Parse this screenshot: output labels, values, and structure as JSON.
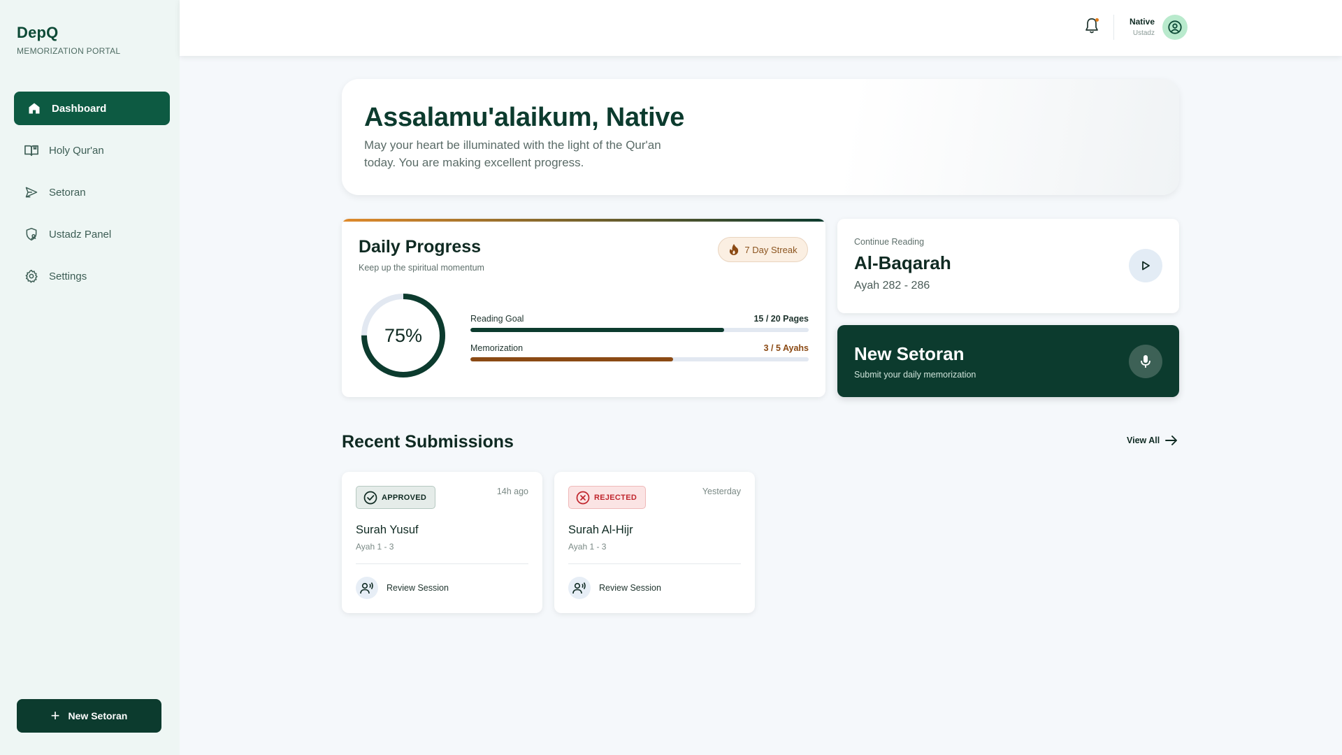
{
  "brand": {
    "name": "DepQ",
    "subtitle": "MEMORIZATION PORTAL"
  },
  "sidebar": {
    "items": [
      {
        "label": "Dashboard",
        "icon": "home-icon",
        "active": true
      },
      {
        "label": "Holy Qur'an",
        "icon": "book-open-icon",
        "active": false
      },
      {
        "label": "Setoran",
        "icon": "send-icon",
        "active": false
      },
      {
        "label": "Ustadz Panel",
        "icon": "shield-user-icon",
        "active": false
      },
      {
        "label": "Settings",
        "icon": "gear-icon",
        "active": false
      }
    ],
    "new_button_label": "New Setoran"
  },
  "header": {
    "notification_icon": "bell-icon",
    "user_name": "Native",
    "user_role": "Ustadz",
    "avatar_icon": "user-circle-icon"
  },
  "welcome": {
    "title": "Assalamu'alaikum, Native",
    "message": "May your heart be illuminated with the light of the Qur'an today. You are making excellent progress."
  },
  "daily_progress": {
    "title": "Daily Progress",
    "subtitle": "Keep up the spiritual momentum",
    "streak": "7 Day Streak",
    "percent_label": "75%",
    "percent": 0.75,
    "bars": [
      {
        "label": "Reading Goal",
        "value": "15 / 20 Pages",
        "fraction": 0.75,
        "color": "#0c3b2e"
      },
      {
        "label": "Memorization",
        "value": "3 / 5 Ayahs",
        "fraction": 0.6,
        "color": "#8b4a14"
      }
    ]
  },
  "continue_reading": {
    "label": "Continue Reading",
    "surah": "Al-Baqarah",
    "ayah": "Ayah 282 - 286"
  },
  "new_setoran": {
    "title": "New Setoran",
    "subtitle": "Submit your daily memorization"
  },
  "recent": {
    "title": "Recent Submissions",
    "view_all": "View All",
    "items": [
      {
        "status": "APPROVED",
        "time": "14h ago",
        "surah": "Surah Yusuf",
        "ayah": "Ayah 1 - 3",
        "action": "Review Session"
      },
      {
        "status": "REJECTED",
        "time": "Yesterday",
        "surah": "Surah Al-Hijr",
        "ayah": "Ayah 1 - 3",
        "action": "Review Session"
      }
    ]
  },
  "colors": {
    "primary": "#0c3b2e",
    "accent": "#0d5a42",
    "warm": "#8b4a14",
    "rejected": "#c0262d"
  }
}
